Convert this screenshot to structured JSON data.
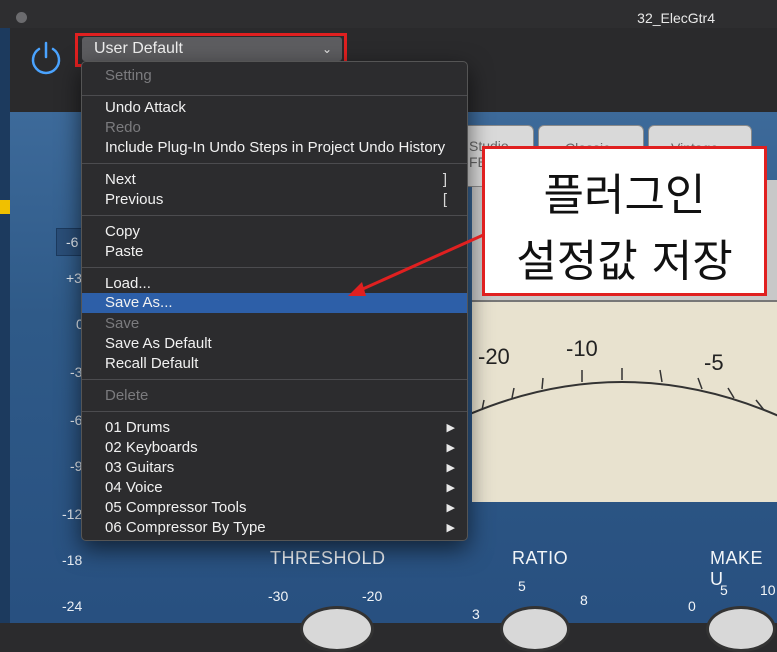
{
  "window": {
    "title": "32_ElecGtr4"
  },
  "header": {
    "preset_value": "User Default",
    "power_icon": "power-icon"
  },
  "scale_labels": [
    "-6",
    "+3",
    "0",
    "-3",
    "-6",
    "-9",
    "-12",
    "-18",
    "-24"
  ],
  "tabs": [
    "Studio FET",
    "Classic",
    "Vintage"
  ],
  "meter_numbers": [
    "-20",
    "-10",
    "-5"
  ],
  "knobs": {
    "threshold": {
      "label": "THRESHOLD",
      "ticks": [
        "-30",
        "-20"
      ]
    },
    "ratio": {
      "label": "RATIO",
      "ticks": [
        "5",
        "8",
        "3"
      ]
    },
    "makeup": {
      "label": "MAKE U",
      "ticks": [
        "0",
        "5",
        "10"
      ]
    }
  },
  "menu": {
    "items": [
      {
        "label": "Setting",
        "disabled": true
      },
      {
        "label": "Undo Attack"
      },
      {
        "label": "Redo",
        "disabled": true
      },
      {
        "label": "Include Plug-In Undo Steps in Project Undo History"
      },
      {
        "label": "Next",
        "shortcut": "]"
      },
      {
        "label": "Previous",
        "shortcut": "["
      },
      {
        "label": "Copy"
      },
      {
        "label": "Paste"
      },
      {
        "label": "Load..."
      },
      {
        "label": "Save As...",
        "selected": true
      },
      {
        "label": "Save",
        "disabled": true
      },
      {
        "label": "Save As Default"
      },
      {
        "label": "Recall Default"
      },
      {
        "label": "Delete",
        "disabled": true
      },
      {
        "label": "01 Drums",
        "submenu": true
      },
      {
        "label": "02 Keyboards",
        "submenu": true
      },
      {
        "label": "03 Guitars",
        "submenu": true
      },
      {
        "label": "04 Voice",
        "submenu": true
      },
      {
        "label": "05 Compressor Tools",
        "submenu": true
      },
      {
        "label": "06 Compressor By Type",
        "submenu": true
      }
    ]
  },
  "callout": {
    "line1": "플러그인",
    "line2": "설정값 저장"
  },
  "colors": {
    "highlight": "#2d5fa8",
    "annotation": "#e02020",
    "plugin_bg": "#2f5a88"
  }
}
